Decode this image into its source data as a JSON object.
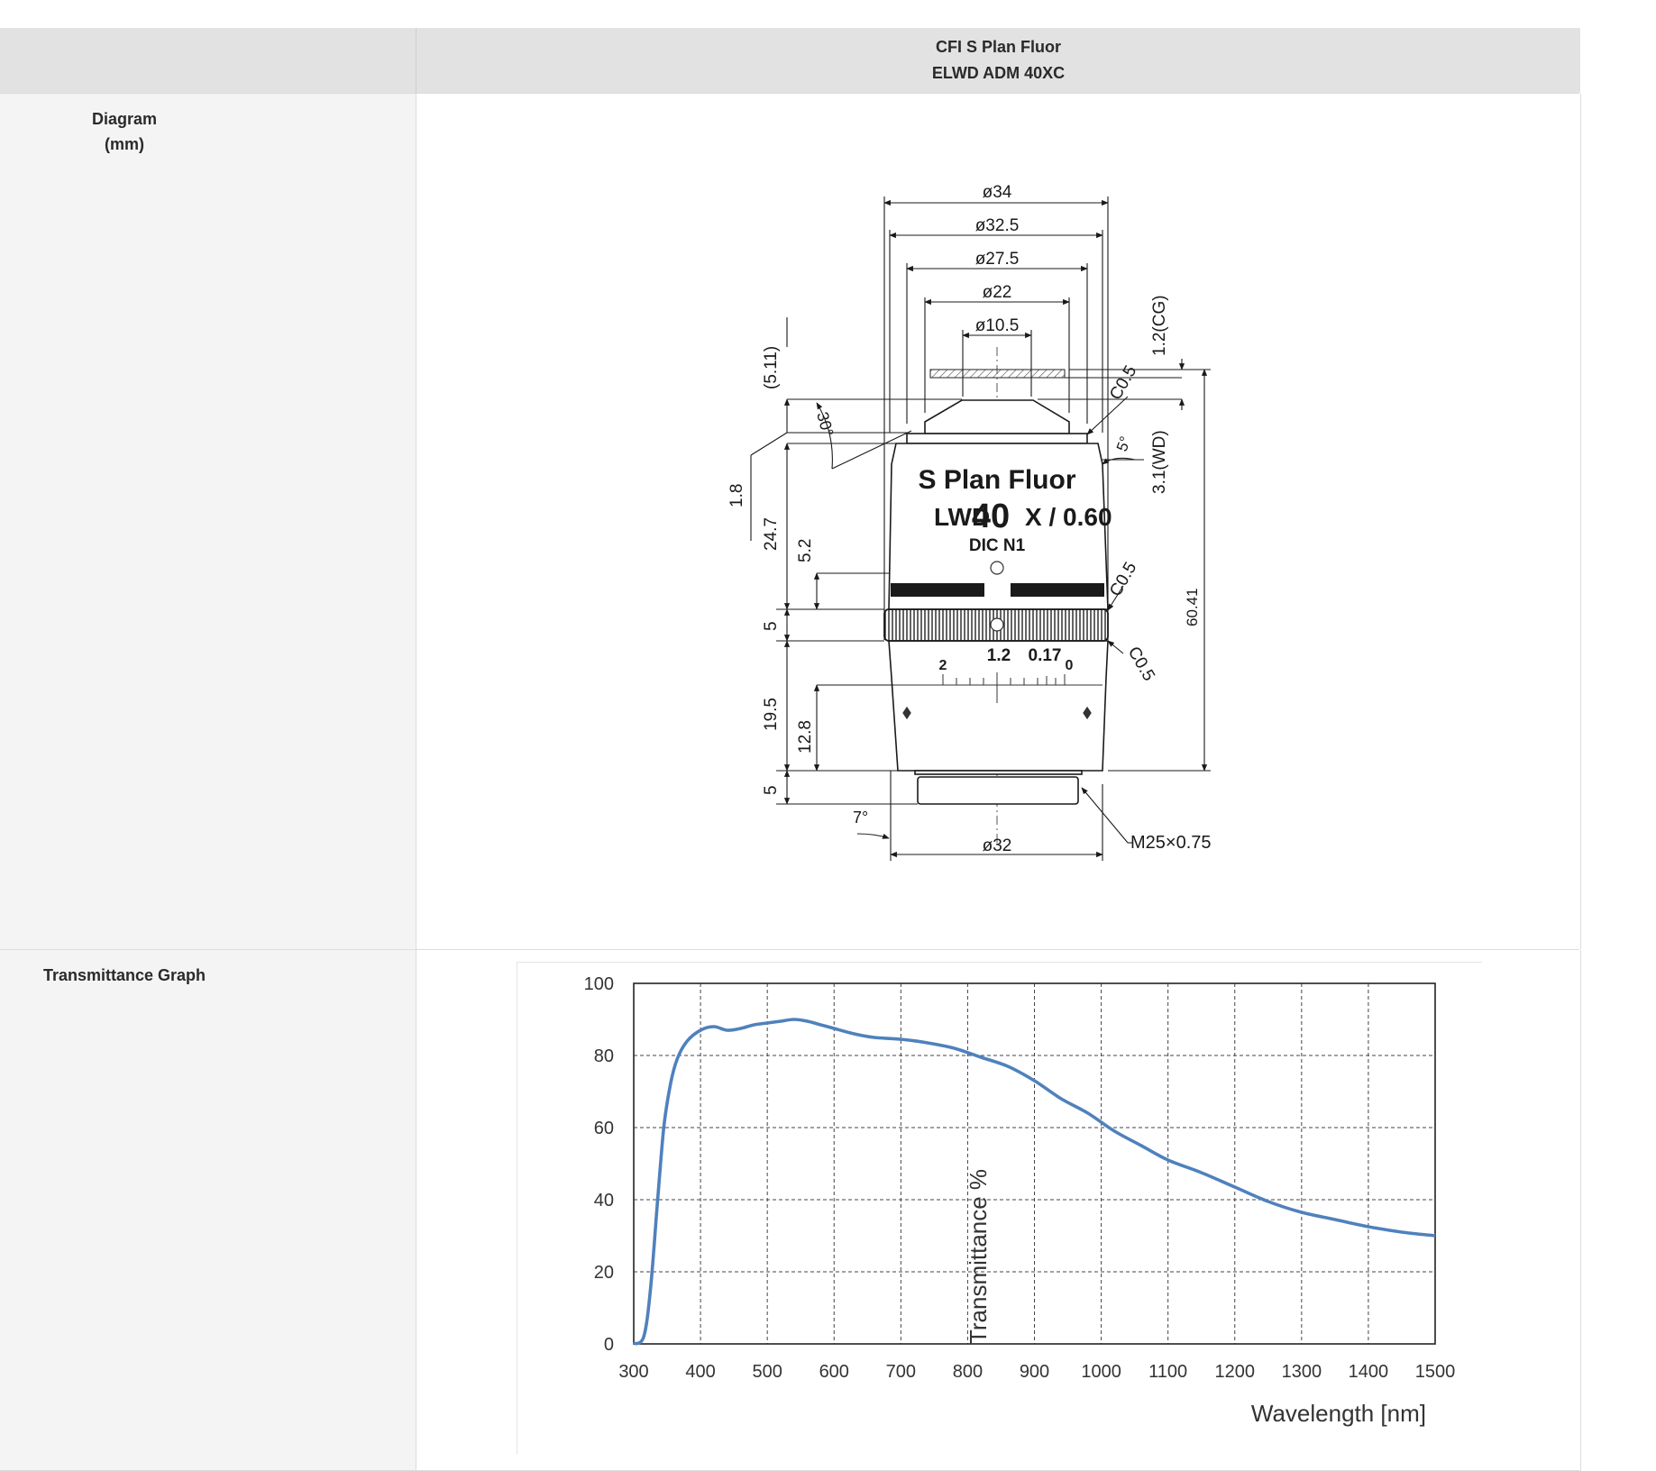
{
  "header": {
    "product_line1": "CFI S Plan Fluor",
    "product_line2": "ELWD ADM 40XC"
  },
  "rows": {
    "diagram_label_line1": "Diagram",
    "diagram_label_line2": "(mm)",
    "transmittance_label": "Transmittance Graph"
  },
  "diagram": {
    "engraving_line1": "S Plan Fluor",
    "engraving_lwd": "LWD",
    "engraving_mag": "40",
    "engraving_na": "X / 0.60",
    "engraving_line3": "DIC N1",
    "dims": {
      "d34": "ø34",
      "d325": "ø32.5",
      "d275": "ø27.5",
      "d22": "ø22",
      "d105": "ø10.5",
      "d32": "ø32",
      "cg": "1.2(CG)",
      "wd": "3.1(WD)",
      "c05a": "C0.5",
      "c05b": "C0.5",
      "c05c": "C0.5",
      "ang5": "5°",
      "ang30": "30°",
      "ang7": "7°",
      "total": "60.41",
      "v511": "(5.11)",
      "v18": "1.8",
      "v247": "24.7",
      "v52": "5.2",
      "v5a": "5",
      "v195": "19.5",
      "v128": "12.8",
      "v5b": "5",
      "thread": "M25×0.75",
      "scale_2": "2",
      "scale_12": "1.2",
      "scale_017": "0.17",
      "scale_0": "0"
    }
  },
  "chart_data": {
    "type": "line",
    "title": "",
    "xlabel": "Wavelength [nm]",
    "ylabel": "Transmittance %",
    "xlim": [
      300,
      1500
    ],
    "ylim": [
      0,
      100
    ],
    "xticks": [
      300,
      400,
      500,
      600,
      700,
      800,
      900,
      1000,
      1100,
      1200,
      1300,
      1400,
      1500
    ],
    "yticks": [
      0,
      20,
      40,
      60,
      80,
      100
    ],
    "grid": true,
    "line_color": "#4f81bd",
    "series": [
      {
        "name": "",
        "x": [
          300,
          315,
          325,
          335,
          345,
          355,
          365,
          380,
          400,
          420,
          440,
          460,
          480,
          500,
          520,
          540,
          560,
          580,
          600,
          630,
          660,
          700,
          740,
          780,
          820,
          860,
          900,
          940,
          980,
          1020,
          1060,
          1100,
          1150,
          1200,
          1250,
          1300,
          1350,
          1400,
          1450,
          1500
        ],
        "y": [
          0,
          2,
          15,
          38,
          60,
          72,
          79,
          84,
          87,
          88,
          87,
          87.5,
          88.5,
          89,
          89.5,
          90,
          89.5,
          88.5,
          87.5,
          86,
          85,
          84.5,
          83.5,
          82,
          79.5,
          77,
          73,
          68,
          64,
          59,
          55,
          51,
          47.5,
          43.5,
          39.5,
          36.5,
          34.5,
          32.5,
          31,
          30
        ]
      }
    ]
  }
}
